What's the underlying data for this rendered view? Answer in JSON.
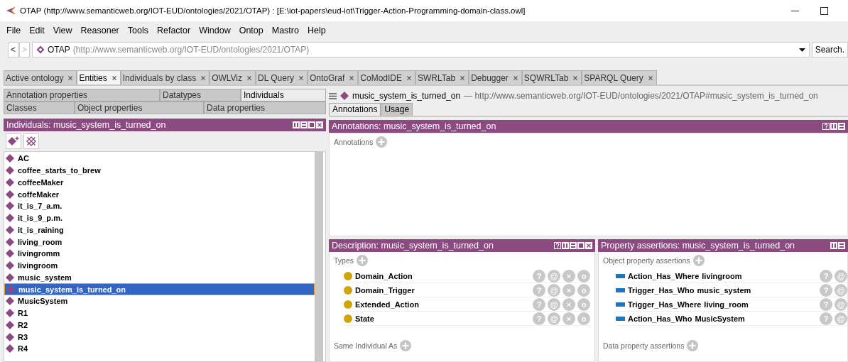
{
  "window": {
    "title": "OTAP (http://www.semanticweb.org/IOT-EUD/ontologies/2021/OTAP)  : [E:\\iot-papers\\eud-iot\\Trigger-Action-Programming-domain-class.owl]"
  },
  "menu": [
    "File",
    "Edit",
    "View",
    "Reasoner",
    "Tools",
    "Refactor",
    "Window",
    "Ontop",
    "Mastro",
    "Help"
  ],
  "address_bar": {
    "back": {
      "label": "<",
      "disabled": false
    },
    "forward": {
      "label": ">",
      "disabled": true
    },
    "ontology": "OTAP",
    "iri": "(http://www.semanticweb.org/IOT-EUD/ontologies/2021/OTAP)",
    "search_button": "Search."
  },
  "tabs": [
    {
      "label": "Active ontology",
      "selected": false
    },
    {
      "label": "Entities",
      "selected": true
    },
    {
      "label": "Individuals by class",
      "selected": false
    },
    {
      "label": "OWLViz",
      "selected": false
    },
    {
      "label": "DL Query",
      "selected": false
    },
    {
      "label": "OntoGraf",
      "selected": false
    },
    {
      "label": "CoModIDE",
      "selected": false
    },
    {
      "label": "SWRLTab",
      "selected": false
    },
    {
      "label": "Debugger",
      "selected": false
    },
    {
      "label": "SQWRLTab",
      "selected": false
    },
    {
      "label": "SPARQL Query",
      "selected": false
    }
  ],
  "entity_tabs": [
    [
      {
        "label": "Annotation properties",
        "selected": false
      },
      {
        "label": "Datatypes",
        "selected": false
      },
      {
        "label": "Individuals",
        "selected": true
      }
    ],
    [
      {
        "label": "Classes",
        "selected": false
      },
      {
        "label": "Object properties",
        "selected": false
      },
      {
        "label": "Data properties",
        "selected": false
      }
    ]
  ],
  "individuals_view": {
    "title": "Individuals: music_system_is_turned_on",
    "items": [
      {
        "label": "AC",
        "selected": false
      },
      {
        "label": "coffee_starts_to_brew",
        "selected": false
      },
      {
        "label": "coffeeMaker",
        "selected": false
      },
      {
        "label": "coffeMaker",
        "selected": false
      },
      {
        "label": "it_is_7_a.m.",
        "selected": false
      },
      {
        "label": "it_is_9_p.m.",
        "selected": false
      },
      {
        "label": "it_is_raining",
        "selected": false
      },
      {
        "label": "living_room",
        "selected": false
      },
      {
        "label": "livingromm",
        "selected": false
      },
      {
        "label": "livingroom",
        "selected": false
      },
      {
        "label": "music_system",
        "selected": false
      },
      {
        "label": "music_system_is_turned_on",
        "selected": true
      },
      {
        "label": "MusicSystem",
        "selected": false
      },
      {
        "label": "R1",
        "selected": false
      },
      {
        "label": "R2",
        "selected": false
      },
      {
        "label": "R3",
        "selected": false
      },
      {
        "label": "R4",
        "selected": false
      }
    ]
  },
  "entity_header": {
    "name": "music_system_is_turned_on",
    "iri": "— http://www.semanticweb.org/IOT-EUD/ontologies/2021/OTAP#music_system_is_turned_on"
  },
  "view_tabs": [
    {
      "label": "Annotations",
      "selected": true
    },
    {
      "label": "Usage",
      "selected": false
    }
  ],
  "annotations_view": {
    "title": "Annotations: music_system_is_turned_on",
    "section": "Annotations"
  },
  "description_view": {
    "title": "Description: music_system_is_turned_on",
    "types_label": "Types",
    "types": [
      {
        "label": "Domain_Action",
        "buttons": [
          "?",
          "@",
          "×",
          "o"
        ]
      },
      {
        "label": "Domain_Trigger",
        "buttons": [
          "?",
          "@",
          "×",
          "o"
        ]
      },
      {
        "label": "Extended_Action",
        "buttons": [
          "?",
          "@",
          "×",
          "o"
        ]
      },
      {
        "label": "State",
        "buttons": [
          "?",
          "@",
          "×",
          "o"
        ]
      }
    ],
    "same_label": "Same Individual As"
  },
  "property_view": {
    "title": "Property assertions: music_system_is_turned_on",
    "object_label": "Object property assertions",
    "assertions": [
      {
        "property": "Action_Has_Where",
        "value": "livingroom",
        "buttons": [
          "?",
          "@"
        ]
      },
      {
        "property": "Trigger_Has_Who",
        "value": "music_system",
        "buttons": [
          "?",
          "@"
        ]
      },
      {
        "property": "Trigger_Has_Where",
        "value": "living_room",
        "buttons": [
          "?",
          "@"
        ]
      },
      {
        "property": "Action_Has_Who",
        "value": "MusicSystem",
        "buttons": [
          "?",
          "@"
        ]
      }
    ],
    "data_label": "Data property assertions"
  }
}
